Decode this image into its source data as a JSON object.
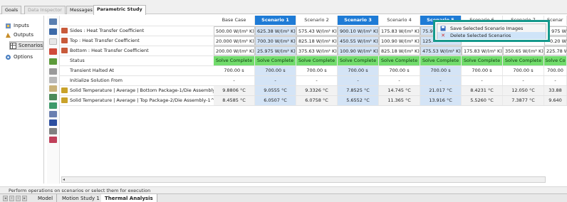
{
  "top_tabs": [
    {
      "label": "Goals",
      "state": "normal"
    },
    {
      "label": "Data Inspector",
      "state": "disabled"
    },
    {
      "label": "Messages",
      "state": "normal"
    },
    {
      "label": "Parametric Study",
      "state": "active"
    }
  ],
  "sidebar": {
    "items": [
      {
        "label": "Inputs",
        "icon": "inputs-icon"
      },
      {
        "label": "Outputs",
        "icon": "outputs-icon"
      },
      {
        "label": "Scenarios",
        "icon": "scenarios-icon"
      },
      {
        "label": "Options",
        "icon": "options-icon"
      }
    ]
  },
  "grid": {
    "headers": [
      "Base Case",
      "Scenario 1",
      "Scenario 2",
      "Scenario 3",
      "Scenario 4",
      "Scenario 5",
      "Scenario 6",
      "Scenario 7",
      "Scenar"
    ],
    "selected_columns": [
      1,
      3,
      5
    ],
    "rows": [
      {
        "label": "Sides : Heat Transfer Coefficient",
        "kind": "input",
        "values": [
          "500.00 W/(m² K)",
          "625.38 W/(m² K)",
          "575.43 W/(m² K)",
          "900.10 W/(m² K)",
          "175.83 W/(m² K)",
          "75.9",
          "",
          "",
          "975 W"
        ]
      },
      {
        "label": "Top : Heat Transfer Coefficient",
        "kind": "input",
        "values": [
          "20.000 W/(m² K)",
          "700.30 W/(m² K)",
          "825.18 W/(m² K)",
          "450.55 W/(m² K)",
          "100.90 W/(m² K)",
          "125.",
          "",
          "",
          "0.20 W"
        ]
      },
      {
        "label": "Bottom : Heat Transfer Coefficient",
        "kind": "input",
        "values": [
          "200.00 W/(m² K)",
          "25.975 W/(m² K)",
          "375.63 W/(m² K)",
          "100.90 W/(m² K)",
          "825.18 W/(m² K)",
          "475.53 W/(m² K)",
          "175.83 W/(m² K)",
          "350.65 W/(m² K)",
          "225.78 W"
        ]
      },
      {
        "label": "Status",
        "kind": "status",
        "values": [
          "Solve Complete",
          "Solve Complete",
          "Solve Complete",
          "Solve Complete",
          "Solve Complete",
          "Solve Complete",
          "Solve Complete",
          "Solve Complete",
          "Solve Co"
        ]
      },
      {
        "label": "Transient Halted At",
        "kind": "plain",
        "values": [
          "700.00 s",
          "700.00 s",
          "700.00 s",
          "700.00 s",
          "700.00 s",
          "700.00 s",
          "700.00 s",
          "700.00 s",
          "700.00"
        ]
      },
      {
        "label": "Initialize Solution From",
        "kind": "plain",
        "values": [
          "-",
          "-",
          "-",
          "-",
          "-",
          "-",
          "-",
          "-",
          "-"
        ]
      },
      {
        "label": "Solid Temperature | Average | Bottom Package-1/Die Assembly-...",
        "kind": "output",
        "values": [
          "9.8806 °C",
          "9.0555 °C",
          "9.3326 °C",
          "7.8525 °C",
          "14.745 °C",
          "21.017 °C",
          "8.4231 °C",
          "12.050 °C",
          "33.88"
        ]
      },
      {
        "label": "Solid Temperature | Average | Top Package-2/Die Assembly-1^T...",
        "kind": "output",
        "values": [
          "8.4585 °C",
          "6.0507 °C",
          "6.0758 °C",
          "5.6552 °C",
          "11.365 °C",
          "13.916 °C",
          "5.5260 °C",
          "7.3877 °C",
          "9.640"
        ]
      }
    ]
  },
  "context_menu": {
    "items": [
      {
        "label": "Save Selected Scenario Images",
        "icon": "save-images-icon"
      },
      {
        "label": "Delete Selected Scenarios",
        "icon": "delete-icon"
      }
    ]
  },
  "status_bar": "Perform operations on scenarios or select them for execution",
  "bottom_tabs": [
    "Model",
    "Motion Study 1",
    "Thermal Analysis"
  ],
  "colors": {
    "accent_blue": "#1e7bd6",
    "status_green": "#72dc6c",
    "menu_frame": "#16998c"
  }
}
